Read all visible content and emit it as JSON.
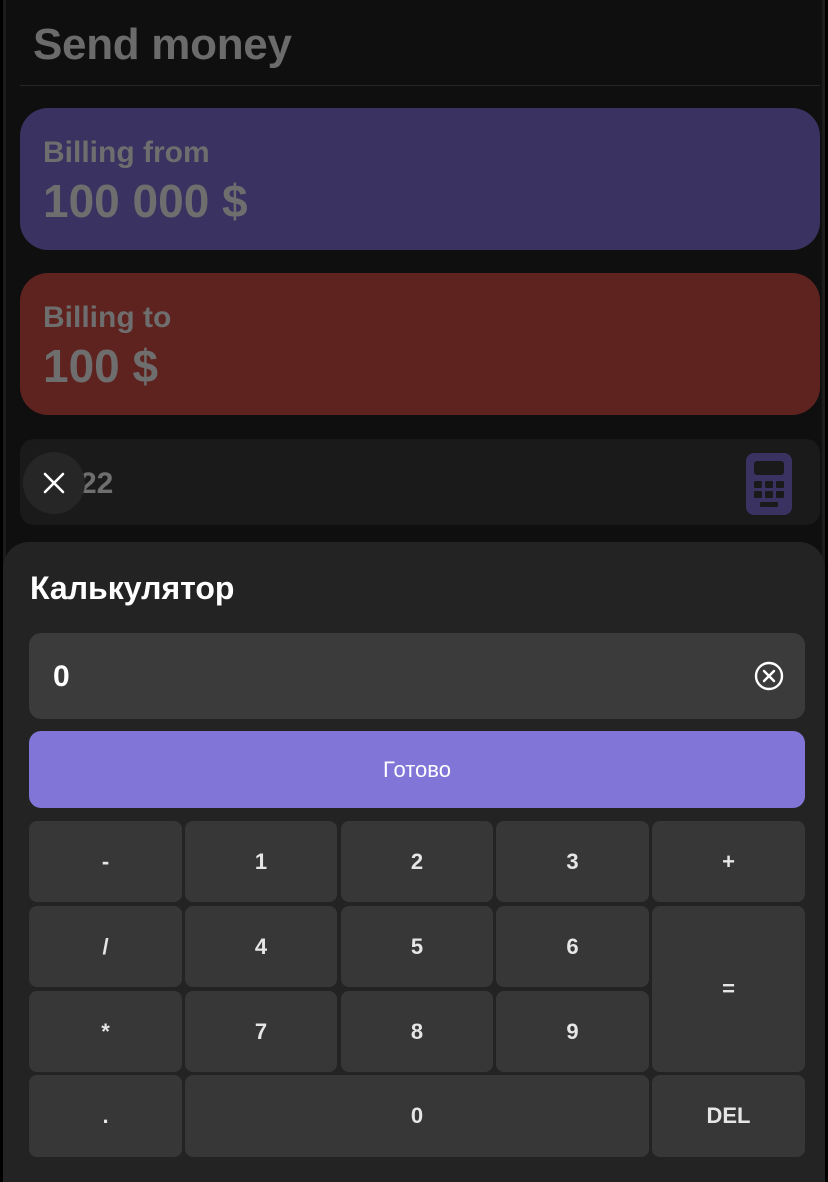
{
  "header": {
    "title": "Send money"
  },
  "billing_from": {
    "label": "Billing from",
    "amount": "100 000 $"
  },
  "billing_to": {
    "label": "Billing to",
    "amount": "100 $"
  },
  "amount_field": {
    "value": "22"
  },
  "calculator": {
    "title": "Калькулятор",
    "display_value": "0",
    "done_label": "Готово",
    "keys": {
      "minus": "-",
      "one": "1",
      "two": "2",
      "three": "3",
      "plus": "+",
      "divide": "/",
      "four": "4",
      "five": "5",
      "six": "6",
      "equals": "=",
      "multiply": "*",
      "seven": "7",
      "eight": "8",
      "nine": "9",
      "dot": ".",
      "zero": "0",
      "del": "DEL"
    }
  },
  "colors": {
    "accent": "#8175d8",
    "billing_from_bg": "#3a3260",
    "billing_to_bg": "#5e221f",
    "sheet_bg": "#232323",
    "key_bg": "#373737"
  },
  "icons": {
    "close": "close-icon",
    "calculator": "calculator-icon",
    "clear_input": "clear-circle-icon"
  }
}
